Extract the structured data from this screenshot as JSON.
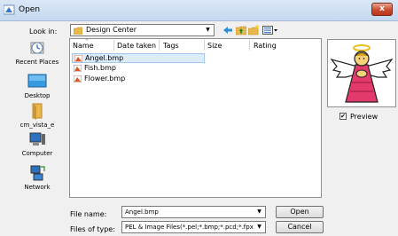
{
  "window": {
    "title": "Open",
    "close_label": "x"
  },
  "lookin": {
    "label": "Look in:",
    "value": "Design Center"
  },
  "places": [
    {
      "label": "Recent Places"
    },
    {
      "label": "Desktop"
    },
    {
      "label": "cm_vista_e"
    },
    {
      "label": "Computer"
    },
    {
      "label": "Network"
    }
  ],
  "columns": [
    "Name",
    "Date taken",
    "Tags",
    "Size",
    "Rating"
  ],
  "files": [
    {
      "name": "Angel.bmp",
      "selected": true
    },
    {
      "name": "Fish.bmp",
      "selected": false
    },
    {
      "name": "Flower.bmp",
      "selected": false
    }
  ],
  "preview": {
    "label": "Preview",
    "checked": true
  },
  "filename": {
    "label": "File name:",
    "value": "Angel.bmp"
  },
  "filetype": {
    "label": "Files of type:",
    "value": "PEL & Image Files(*.pel;*.bmp;*.pcd;*.fpx;*.tif;*.j"
  },
  "buttons": {
    "open": "Open",
    "cancel": "Cancel"
  },
  "colors": {
    "accent": "#2a5ea8",
    "folder": "#e8b84a",
    "close": "#c84a2f",
    "selection": "#ddecfb"
  }
}
